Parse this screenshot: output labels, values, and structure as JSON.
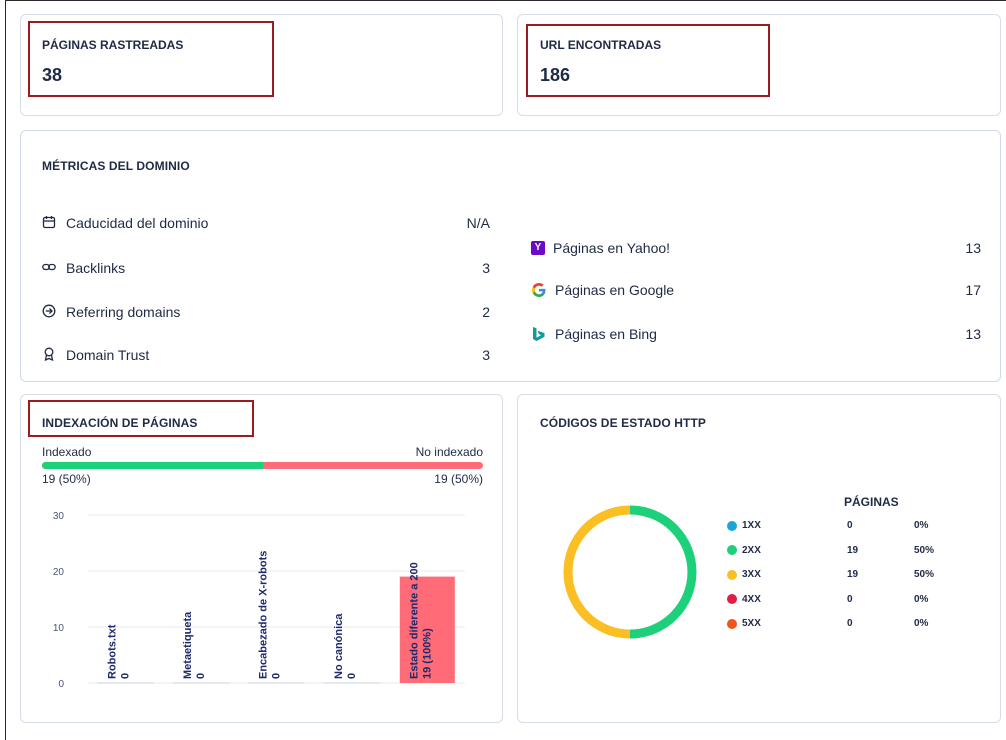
{
  "stats": {
    "crawled": {
      "label": "PÁGINAS RASTREADAS",
      "value": "38"
    },
    "urls": {
      "label": "URL ENCONTRADAS",
      "value": "186"
    }
  },
  "domain_metrics": {
    "title": "MÉTRICAS DEL DOMINIO",
    "left": [
      {
        "icon": "calendar-icon",
        "label": "Caducidad del dominio",
        "value": "N/A"
      },
      {
        "icon": "link-icon",
        "label": "Backlinks",
        "value": "3"
      },
      {
        "icon": "arrow-circle-icon",
        "label": "Referring domains",
        "value": "2"
      },
      {
        "icon": "award-icon",
        "label": "Domain Trust",
        "value": "3"
      }
    ],
    "right": [
      {
        "icon": "yahoo-icon",
        "label": "Páginas en Yahoo!",
        "value": "13"
      },
      {
        "icon": "google-icon",
        "label": "Páginas en Google",
        "value": "17"
      },
      {
        "icon": "bing-icon",
        "label": "Páginas en Bing",
        "value": "13"
      }
    ]
  },
  "indexing": {
    "title": "INDEXACIÓN DE PÁGINAS",
    "indexed_label": "Indexado",
    "indexed_value": "19 (50%)",
    "not_indexed_label": "No indexado",
    "not_indexed_value": "19 (50%)",
    "indexed_fraction": 0.5,
    "colors": {
      "indexed": "#1dd07a",
      "not_indexed": "#ff6b76"
    }
  },
  "http_status": {
    "title": "CÓDIGOS DE ESTADO HTTP",
    "column_header": "PÁGINAS",
    "rows": [
      {
        "code": "1XX",
        "count": "0",
        "pct": "0%",
        "color": "#1ca6d8"
      },
      {
        "code": "2XX",
        "count": "19",
        "pct": "50%",
        "color": "#1dd07a"
      },
      {
        "code": "3XX",
        "count": "19",
        "pct": "50%",
        "color": "#fbbf24"
      },
      {
        "code": "4XX",
        "count": "0",
        "pct": "0%",
        "color": "#e11d48"
      },
      {
        "code": "5XX",
        "count": "0",
        "pct": "0%",
        "color": "#f2541d"
      }
    ]
  },
  "chart_data": [
    {
      "type": "bar",
      "title": "",
      "categories": [
        "Robots.txt",
        "Metaetiqueta",
        "Encabezado de X-robots",
        "No canónica",
        "Estado diferente a 200"
      ],
      "values": [
        0,
        0,
        0,
        0,
        19
      ],
      "value_labels": [
        "0",
        "0",
        "0",
        "0",
        "19 (100%)"
      ],
      "ylim": [
        0,
        30
      ],
      "yticks": [
        "0",
        "10",
        "20",
        "30"
      ],
      "bar_color": "#ff6b76",
      "grid": true
    },
    {
      "type": "pie",
      "title": "",
      "labels": [
        "1XX",
        "2XX",
        "3XX",
        "4XX",
        "5XX"
      ],
      "values": [
        0,
        19,
        19,
        0,
        0
      ],
      "colors": [
        "#1ca6d8",
        "#1dd07a",
        "#fbbf24",
        "#e11d48",
        "#f2541d"
      ]
    }
  ]
}
